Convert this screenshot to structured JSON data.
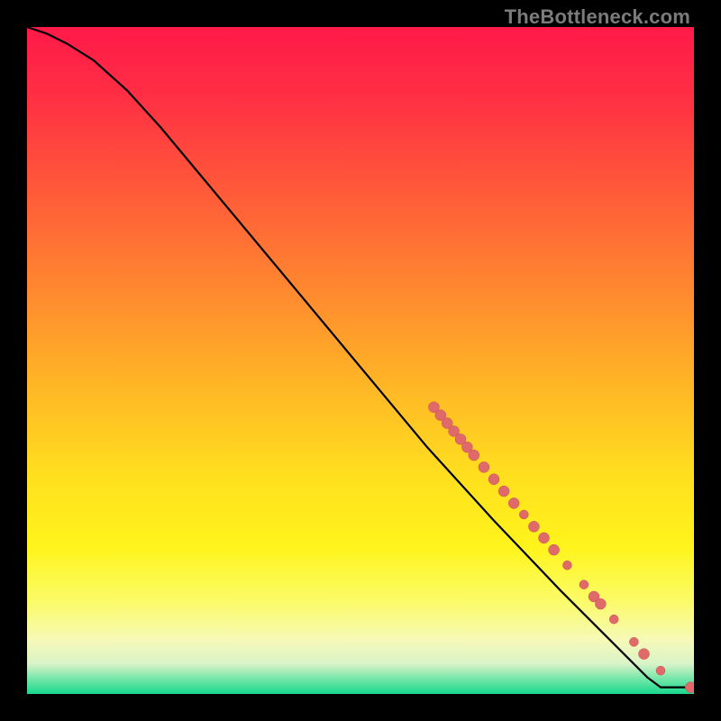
{
  "watermark": "TheBottleneck.com",
  "colors": {
    "gradient_stops": [
      {
        "offset": 0.0,
        "color": "#ff1a49"
      },
      {
        "offset": 0.1,
        "color": "#ff2e44"
      },
      {
        "offset": 0.25,
        "color": "#ff5b39"
      },
      {
        "offset": 0.4,
        "color": "#ff8a2f"
      },
      {
        "offset": 0.55,
        "color": "#ffba25"
      },
      {
        "offset": 0.68,
        "color": "#ffe11e"
      },
      {
        "offset": 0.78,
        "color": "#fff41c"
      },
      {
        "offset": 0.86,
        "color": "#fbfb67"
      },
      {
        "offset": 0.92,
        "color": "#f6f9b8"
      },
      {
        "offset": 0.955,
        "color": "#d9f3c9"
      },
      {
        "offset": 0.975,
        "color": "#7fe7ac"
      },
      {
        "offset": 1.0,
        "color": "#17d98e"
      }
    ],
    "curve": "#000000",
    "marker_fill": "#e06a6a",
    "marker_stroke": "#c95050",
    "background": "#000000"
  },
  "chart_data": {
    "type": "line",
    "title": "",
    "xlabel": "",
    "ylabel": "",
    "xlim": [
      0,
      100
    ],
    "ylim": [
      0,
      100
    ],
    "grid": false,
    "legend": false,
    "curve": [
      {
        "x": 0,
        "y": 100
      },
      {
        "x": 3,
        "y": 99
      },
      {
        "x": 6,
        "y": 97.5
      },
      {
        "x": 10,
        "y": 95
      },
      {
        "x": 15,
        "y": 90.5
      },
      {
        "x": 20,
        "y": 85
      },
      {
        "x": 30,
        "y": 73
      },
      {
        "x": 40,
        "y": 61
      },
      {
        "x": 50,
        "y": 49
      },
      {
        "x": 60,
        "y": 37
      },
      {
        "x": 70,
        "y": 26
      },
      {
        "x": 80,
        "y": 15.5
      },
      {
        "x": 85,
        "y": 10.5
      },
      {
        "x": 90,
        "y": 5.5
      },
      {
        "x": 93,
        "y": 2.5
      },
      {
        "x": 95,
        "y": 1
      },
      {
        "x": 100,
        "y": 1
      }
    ],
    "markers": [
      {
        "x": 61,
        "y": 43.0,
        "r": 6
      },
      {
        "x": 62,
        "y": 41.8,
        "r": 6
      },
      {
        "x": 63,
        "y": 40.6,
        "r": 6
      },
      {
        "x": 64,
        "y": 39.4,
        "r": 6
      },
      {
        "x": 65,
        "y": 38.2,
        "r": 6
      },
      {
        "x": 66,
        "y": 37.0,
        "r": 6
      },
      {
        "x": 67,
        "y": 35.8,
        "r": 6
      },
      {
        "x": 68.5,
        "y": 34.0,
        "r": 6
      },
      {
        "x": 70,
        "y": 32.2,
        "r": 6
      },
      {
        "x": 71.5,
        "y": 30.4,
        "r": 6
      },
      {
        "x": 73,
        "y": 28.6,
        "r": 6
      },
      {
        "x": 74.5,
        "y": 26.9,
        "r": 5
      },
      {
        "x": 76,
        "y": 25.1,
        "r": 6
      },
      {
        "x": 77.5,
        "y": 23.4,
        "r": 6
      },
      {
        "x": 79,
        "y": 21.6,
        "r": 6
      },
      {
        "x": 81,
        "y": 19.3,
        "r": 5
      },
      {
        "x": 83.5,
        "y": 16.4,
        "r": 5
      },
      {
        "x": 85,
        "y": 14.6,
        "r": 6
      },
      {
        "x": 86,
        "y": 13.5,
        "r": 6
      },
      {
        "x": 88,
        "y": 11.2,
        "r": 5
      },
      {
        "x": 91,
        "y": 7.8,
        "r": 5
      },
      {
        "x": 92.5,
        "y": 6.0,
        "r": 6
      },
      {
        "x": 95,
        "y": 3.5,
        "r": 5
      },
      {
        "x": 99.5,
        "y": 1.0,
        "r": 6
      }
    ]
  }
}
